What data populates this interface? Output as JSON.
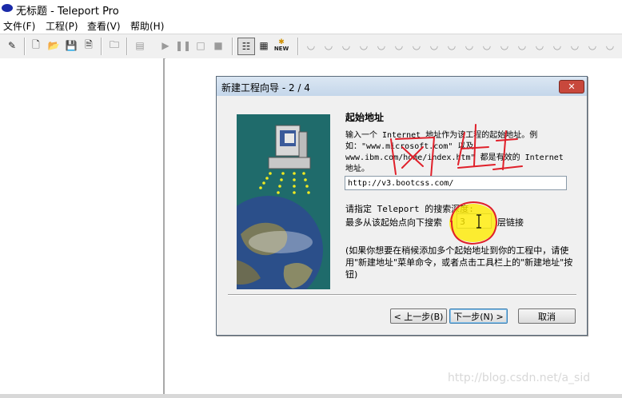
{
  "window": {
    "title": "无标题 - Teleport Pro"
  },
  "menu": [
    {
      "label": "文件(F)"
    },
    {
      "label": "工程(P)"
    },
    {
      "label": "查看(V)"
    },
    {
      "label": "帮助(H)"
    }
  ],
  "toolbar": {
    "new_badge": "NEW"
  },
  "dialog": {
    "title": "新建工程向导 - 2 / 4",
    "close_glyph": "✕",
    "heading": "起始地址",
    "description": "输入一个 Internet 地址作为该工程的起始地址。例如：\"www.microsoft.com\" 以及 www.ibm.com/home/index.htm\" 都是有效的 Internet 地址。",
    "url_value": "http://v3.bootcss.com/",
    "depth_label": "请指定 Teleport 的搜索深度:",
    "depth_prefix": "最多从该起始点向下搜索",
    "depth_value": "3",
    "depth_suffix": "层链接",
    "note": "(如果你想要在稍候添加多个起始地址到你的工程中，请使用\"新建地址\"菜单命令，或者点击工具栏上的\"新建地址\"按钮)",
    "buttons": {
      "back": "< 上一步(B)",
      "next": "下一步(N) >",
      "cancel": "取消"
    }
  },
  "annotation": {
    "handwritten": "网址",
    "color": "#e0202a"
  },
  "watermark": "http://blog.csdn.net/a_sid"
}
